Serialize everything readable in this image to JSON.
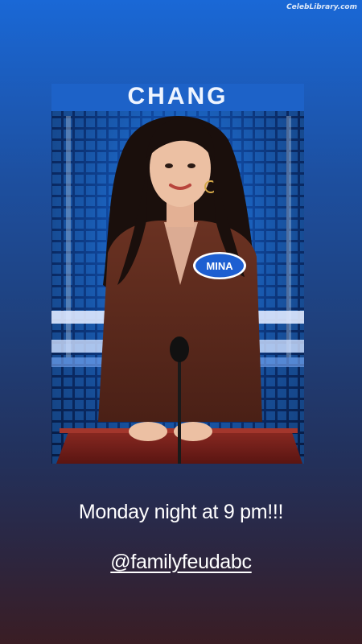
{
  "watermark": "CelebLibrary.com",
  "photo": {
    "backdrop_sign": "CHANG",
    "name_tag": "MINA",
    "colors": {
      "backdrop": "#114da8",
      "sign": "#1d62c8",
      "podium": "#7a1f1c",
      "name_tag": "#1d5fd1",
      "outfit": "#5a2a1c"
    }
  },
  "caption": {
    "text": "Monday night at 9 pm!!!",
    "handle": "@familyfeudabc"
  }
}
